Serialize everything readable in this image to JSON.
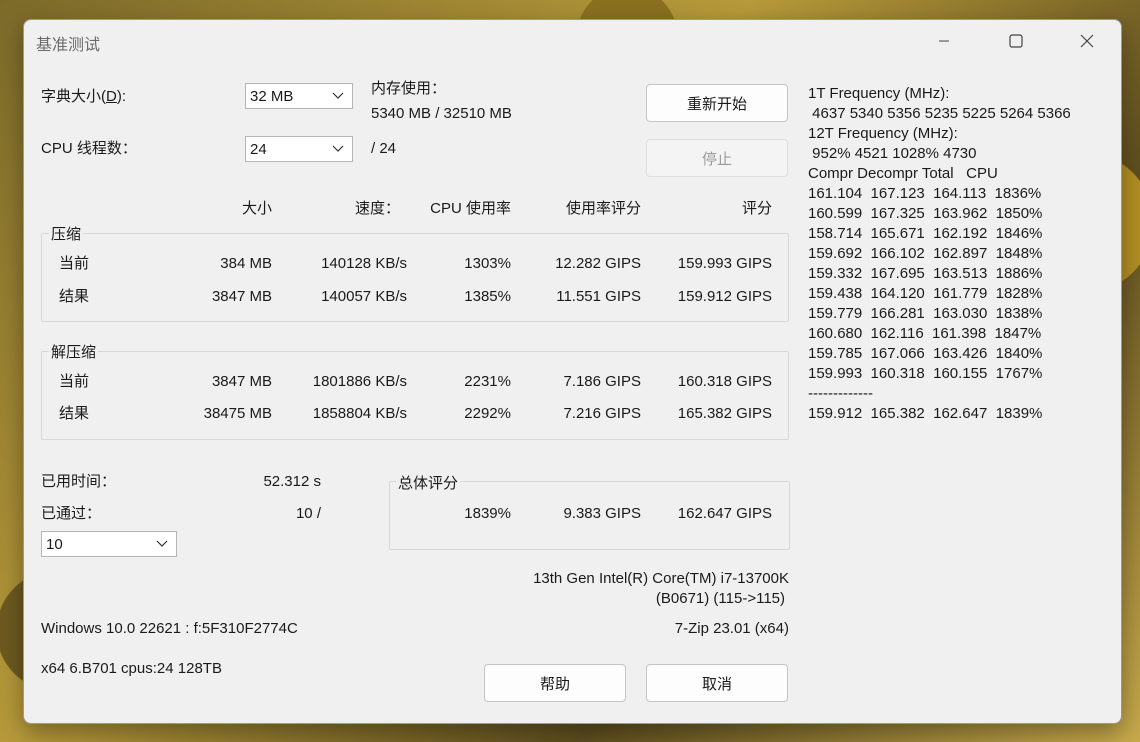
{
  "window": {
    "title": "基准测试"
  },
  "dict": {
    "label": "字典大小(D):",
    "label_pre": "字典大小(",
    "label_key": "D",
    "label_post": "):",
    "value": "32 MB"
  },
  "memory": {
    "label": "内存使用：",
    "value": "5340 MB / 32510 MB"
  },
  "threads": {
    "label": "CPU 线程数：",
    "value": "24",
    "max": "/ 24"
  },
  "buttons": {
    "restart": "重新开始",
    "stop": "停止",
    "help": "帮助",
    "cancel": "取消"
  },
  "columns": {
    "size": "大小",
    "speed": "速度：",
    "cpu_usage": "CPU 使用率",
    "usage_rating": "使用率评分",
    "rating": "评分"
  },
  "compress": {
    "label": "压缩",
    "rows": [
      {
        "name": "当前",
        "size": "384 MB",
        "speed": "140128 KB/s",
        "cpu": "1303%",
        "usage_rating": "12.282 GIPS",
        "rating": "159.993 GIPS"
      },
      {
        "name": "结果",
        "size": "3847 MB",
        "speed": "140057 KB/s",
        "cpu": "1385%",
        "usage_rating": "11.551 GIPS",
        "rating": "159.912 GIPS"
      }
    ]
  },
  "decompress": {
    "label": "解压缩",
    "rows": [
      {
        "name": "当前",
        "size": "3847 MB",
        "speed": "1801886 KB/s",
        "cpu": "2231%",
        "usage_rating": "7.186 GIPS",
        "rating": "160.318 GIPS"
      },
      {
        "name": "结果",
        "size": "38475 MB",
        "speed": "1858804 KB/s",
        "cpu": "2292%",
        "usage_rating": "7.216 GIPS",
        "rating": "165.382 GIPS"
      }
    ]
  },
  "elapsed": {
    "label": "已用时间：",
    "value": "52.312 s"
  },
  "passed": {
    "label": "已通过：",
    "value": "10 /",
    "select_value": "10"
  },
  "total": {
    "label": "总体评分",
    "cpu": "1839%",
    "usage_rating": "9.383 GIPS",
    "rating": "162.647 GIPS"
  },
  "cpu_info": {
    "line1": "13th Gen Intel(R) Core(TM) i7-13700K",
    "line2": "(B0671) (115->115)"
  },
  "os_info": "Windows 10.0 22621 :  f:5F310F2774C",
  "version": "7-Zip 23.01 (x64)",
  "sys_info": "x64 6.B701 cpus:24 128TB",
  "right_pane": {
    "lines": [
      "1T Frequency (MHz):",
      " 4637 5340 5356 5235 5225 5264 5366",
      "12T Frequency (MHz):",
      " 952% 4521 1028% 4730",
      "Compr Decompr Total   CPU",
      "161.104  167.123  164.113  1836%",
      "160.599  167.325  163.962  1850%",
      "158.714  165.671  162.192  1846%",
      "159.692  166.102  162.897  1848%",
      "159.332  167.695  163.513  1886%",
      "159.438  164.120  161.779  1828%",
      "159.779  166.281  163.030  1838%",
      "160.680  162.116  161.398  1847%",
      "159.785  167.066  163.426  1840%",
      "159.993  160.318  160.155  1767%",
      "-------------",
      "159.912  165.382  162.647  1839%"
    ]
  }
}
